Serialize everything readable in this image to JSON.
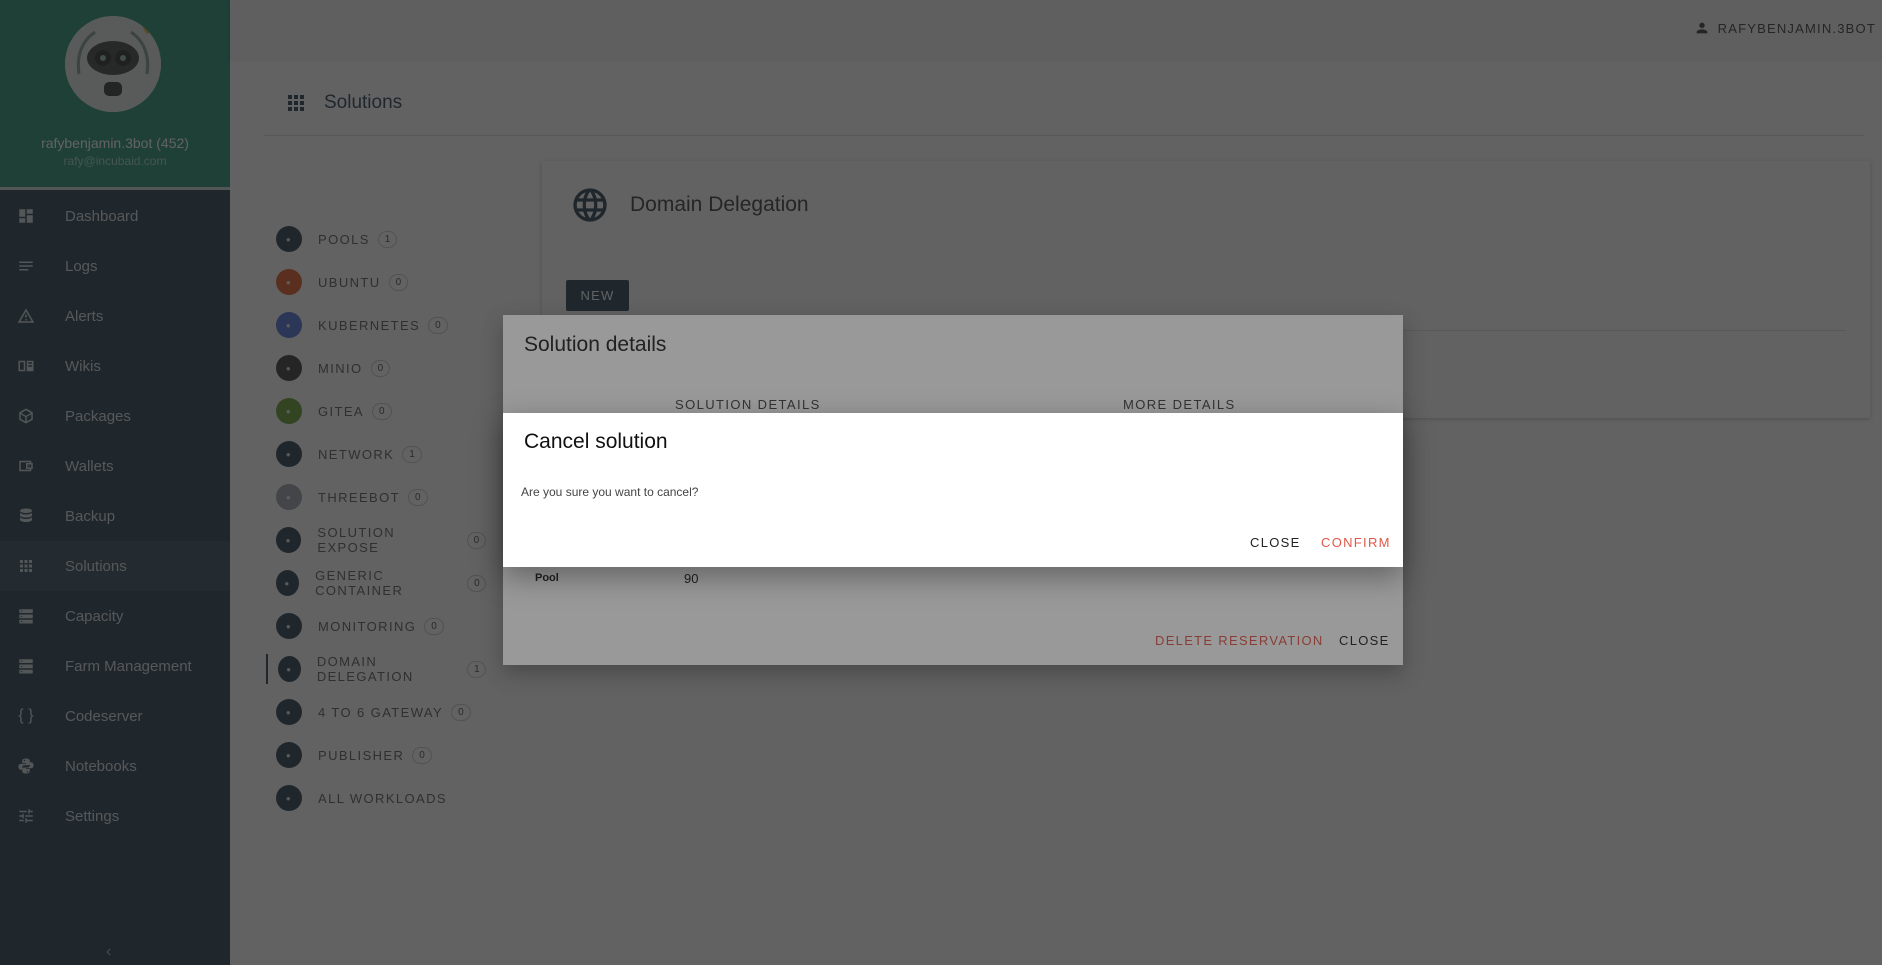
{
  "profile": {
    "name": "rafybenjamin.3bot (452)",
    "email": "rafy@incubaid.com"
  },
  "sidebar": {
    "items": [
      {
        "label": "Dashboard",
        "icon": "dashboard-icon"
      },
      {
        "label": "Logs",
        "icon": "logs-icon"
      },
      {
        "label": "Alerts",
        "icon": "alert-icon"
      },
      {
        "label": "Wikis",
        "icon": "book-icon"
      },
      {
        "label": "Packages",
        "icon": "package-icon"
      },
      {
        "label": "Wallets",
        "icon": "wallet-icon"
      },
      {
        "label": "Backup",
        "icon": "database-icon"
      },
      {
        "label": "Solutions",
        "icon": "apps-grid-icon",
        "active": true
      },
      {
        "label": "Capacity",
        "icon": "server-icon"
      },
      {
        "label": "Farm Management",
        "icon": "server-icon"
      },
      {
        "label": "Codeserver",
        "icon": "code-braces-icon"
      },
      {
        "label": "Notebooks",
        "icon": "python-icon"
      },
      {
        "label": "Settings",
        "icon": "tune-icon"
      }
    ],
    "collapse_icon": "chevron-left-icon"
  },
  "topbar": {
    "user": "RAFYBENJAMIN.3BOT",
    "user_icon": "account-icon"
  },
  "page": {
    "title": "Solutions",
    "icon": "apps-grid-icon"
  },
  "solutions": [
    {
      "label": "POOLS",
      "count": "1",
      "icon": "cloud-icon",
      "color": "#1f3a4f"
    },
    {
      "label": "UBUNTU",
      "count": "0",
      "icon": "ubuntu-icon",
      "color": "#e95420"
    },
    {
      "label": "KUBERNETES",
      "count": "0",
      "icon": "kubernetes-icon",
      "color": "#4a6ad8"
    },
    {
      "label": "MINIO",
      "count": "0",
      "icon": "minio-icon",
      "color": "#333333"
    },
    {
      "label": "GITEA",
      "count": "0",
      "icon": "gitea-icon",
      "color": "#609926"
    },
    {
      "label": "NETWORK",
      "count": "1",
      "icon": "network-icon",
      "color": "#1f3a4f"
    },
    {
      "label": "THREEBOT",
      "count": "0",
      "icon": "threebot-icon",
      "color": "#9aa0a6"
    },
    {
      "label": "SOLUTION EXPOSE",
      "count": "0",
      "icon": "upload-icon",
      "color": "#1f3a4f"
    },
    {
      "label": "GENERIC CONTAINER",
      "count": "0",
      "icon": "folder-icon",
      "color": "#1f3a4f"
    },
    {
      "label": "MONITORING",
      "count": "0",
      "icon": "monitor-icon",
      "color": "#1f3a4f"
    },
    {
      "label": "DOMAIN DELEGATION",
      "count": "1",
      "icon": "globe-icon",
      "color": "#1f3a4f",
      "active": true
    },
    {
      "label": "4 TO 6 GATEWAY",
      "count": "0",
      "icon": "gateway-icon",
      "color": "#1f3a4f"
    },
    {
      "label": "PUBLISHER",
      "count": "0",
      "icon": "web-icon",
      "color": "#1f3a4f"
    },
    {
      "label": "ALL WORKLOADS",
      "count": "",
      "icon": "clipboard-icon",
      "color": "#1f3a4f"
    }
  ],
  "delegation": {
    "title": "Domain Delegation",
    "new_label": "NEW"
  },
  "details_dialog": {
    "title": "Solution details",
    "tabs": [
      "SOLUTION DETAILS",
      "MORE DETAILS"
    ],
    "pool_label": "Pool",
    "pool_value": "90",
    "delete_label": "DELETE RESERVATION",
    "close_label": "CLOSE"
  },
  "cancel_dialog": {
    "title": "Cancel solution",
    "message": "Are you sure you want to cancel?",
    "close_label": "CLOSE",
    "confirm_label": "CONFIRM"
  },
  "colors": {
    "sidebar": "#1f3a4f",
    "profile": "#1c8c6e",
    "danger": "#e0584a"
  }
}
